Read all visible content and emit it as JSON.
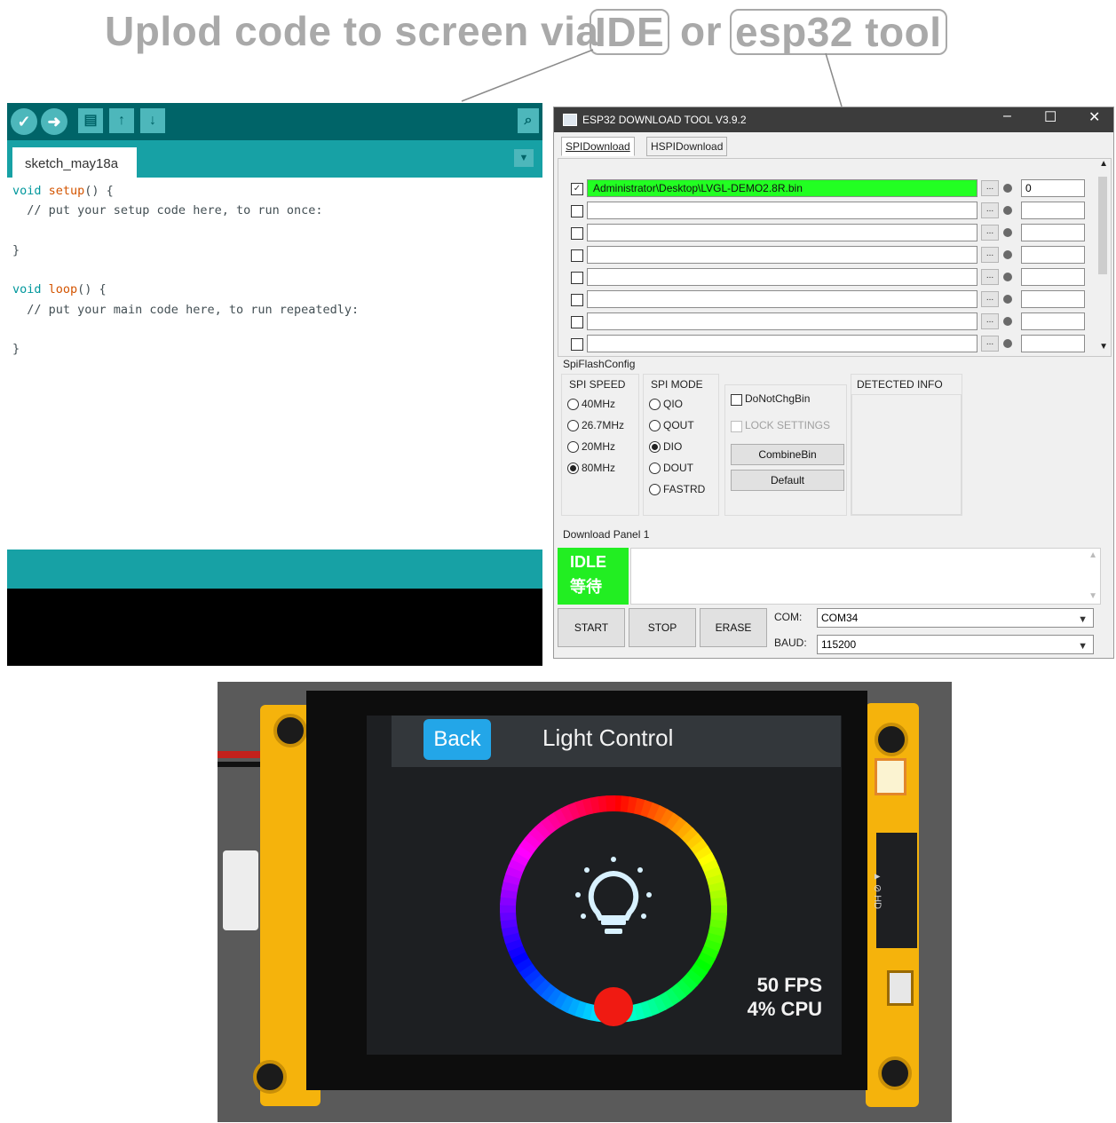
{
  "headline": {
    "text_before": "Uplod code to screen via",
    "ide_label": "IDE",
    "or_text": "or",
    "tool_label": "esp32 tool"
  },
  "ide": {
    "tab_label": "sketch_may18a",
    "code_lines": [
      {
        "kw": "void",
        "fn": "setup",
        "rest": "() {"
      },
      {
        "comment": "  // put your setup code here, to run once:"
      },
      {
        "blank": ""
      },
      {
        "brace": "}"
      },
      {
        "blank": ""
      },
      {
        "kw": "void",
        "fn": "loop",
        "rest": "() {"
      },
      {
        "comment": "  // put your main code here, to run repeatedly:"
      },
      {
        "blank": ""
      },
      {
        "brace": "}"
      }
    ],
    "colors": {
      "toolbar": "#006468",
      "tabbar": "#17a1a5",
      "console": "#000000"
    }
  },
  "esp": {
    "title": "ESP32 DOWNLOAD TOOL V3.9.2",
    "tabs": [
      "SPIDownload",
      "HSPIDownload"
    ],
    "files": [
      {
        "checked": true,
        "path": "Administrator\\Desktop\\LVGL-DEMO2.8R.bin",
        "addr": "0"
      },
      {
        "checked": false,
        "path": "",
        "addr": ""
      },
      {
        "checked": false,
        "path": "",
        "addr": ""
      },
      {
        "checked": false,
        "path": "",
        "addr": ""
      },
      {
        "checked": false,
        "path": "",
        "addr": ""
      },
      {
        "checked": false,
        "path": "",
        "addr": ""
      },
      {
        "checked": false,
        "path": "",
        "addr": ""
      },
      {
        "checked": false,
        "path": "",
        "addr": ""
      }
    ],
    "browse_label": "...",
    "spi_flash_config_label": "SpiFlashConfig",
    "spi_speed_label": "SPI SPEED",
    "spi_speeds": [
      {
        "label": "40MHz",
        "selected": false
      },
      {
        "label": "26.7MHz",
        "selected": false
      },
      {
        "label": "20MHz",
        "selected": false
      },
      {
        "label": "80MHz",
        "selected": true
      }
    ],
    "spi_mode_label": "SPI MODE",
    "spi_modes": [
      {
        "label": "QIO",
        "selected": false
      },
      {
        "label": "QOUT",
        "selected": false
      },
      {
        "label": "DIO",
        "selected": true
      },
      {
        "label": "DOUT",
        "selected": false
      },
      {
        "label": "FASTRD",
        "selected": false
      }
    ],
    "do_not_chg_bin": "DoNotChgBin",
    "lock_settings": "LOCK SETTINGS",
    "combine_bin": "CombineBin",
    "default_btn": "Default",
    "detected_info": "DETECTED INFO",
    "download_panel": "Download Panel 1",
    "status_en": "IDLE",
    "status_cn": "等待",
    "start": "START",
    "stop": "STOP",
    "erase": "ERASE",
    "com_label": "COM:",
    "com_value": "COM34",
    "baud_label": "BAUD:",
    "baud_value": "115200",
    "colors": {
      "titlebar": "#3c3c3c",
      "selected_file": "#22ff22",
      "idle": "#22ee22"
    }
  },
  "device": {
    "back_label": "Back",
    "screen_title": "Light Control",
    "fps": "50 FPS",
    "cpu": "4% CPU",
    "colors": {
      "back_button": "#23a6e8",
      "knob": "#f01a12",
      "icon": "#d8f1ff",
      "pcb": "#f5b30c"
    }
  }
}
